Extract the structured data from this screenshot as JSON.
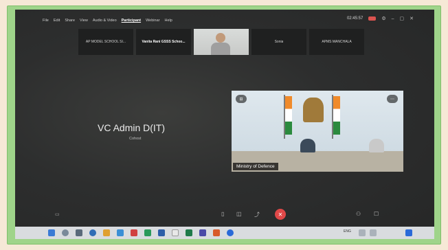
{
  "menu": {
    "items": [
      "File",
      "Edit",
      "Share",
      "View",
      "Audio & Video",
      "Participant",
      "Webinar",
      "Help"
    ],
    "active_index": 5
  },
  "window": {
    "clock": "02:45:57"
  },
  "participants": [
    {
      "name": "AP MODEL SCHOOL SI..."
    },
    {
      "name": "Vanita Rani GSSS Schoo..."
    },
    {
      "name": ""
    },
    {
      "name": "Sonia"
    },
    {
      "name": "APMS MANCHALA"
    }
  ],
  "main_speaker": {
    "name": "VC Admin D(IT)",
    "role": "Cohost"
  },
  "video_feed": {
    "label": "Ministry of Defence"
  },
  "taskbar": {
    "lang": "ENG"
  },
  "colors": {
    "frame": "#9fd48a",
    "background": "#f6e8d6",
    "screen": "#2b2c2c",
    "leave": "#e04848",
    "recording": "#d9534f"
  }
}
